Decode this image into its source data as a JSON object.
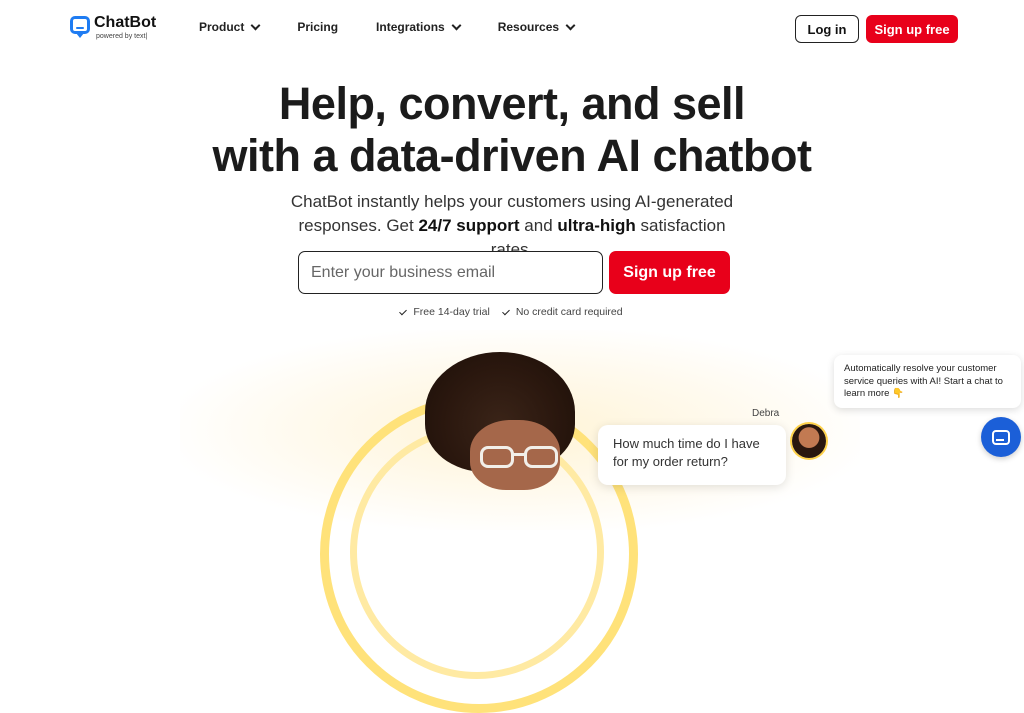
{
  "nav": {
    "logo_name": "ChatBot",
    "logo_sub": "powered by text|",
    "items": [
      {
        "label": "Product",
        "has_dropdown": true
      },
      {
        "label": "Pricing",
        "has_dropdown": false
      },
      {
        "label": "Integrations",
        "has_dropdown": true
      },
      {
        "label": "Resources",
        "has_dropdown": true
      }
    ],
    "login_label": "Log in",
    "signup_label": "Sign up free"
  },
  "hero": {
    "headline_line1": "Help, convert, and sell",
    "headline_line2": "with a data-driven AI chatbot",
    "sub_part1": "ChatBot instantly helps your customers using AI-generated responses. Get ",
    "sub_bold1": "24/7 support",
    "sub_part2": " and ",
    "sub_bold2": "ultra-high",
    "sub_part3": " satisfaction rates.",
    "email_placeholder": "Enter your business email",
    "email_value": "",
    "cta_label": "Sign up free",
    "perks": [
      "Free 14-day trial",
      "No credit card required"
    ]
  },
  "illustration": {
    "chat_name": "Debra",
    "chat_message": "How much time do I have for my order return?"
  },
  "widget": {
    "promo_text": "Automatically resolve your customer service queries with AI! Start a chat to learn more 👇",
    "launcher_icon": "chat-icon"
  },
  "colors": {
    "brand_red": "#e8001a",
    "brand_blue": "#1f7cf2",
    "launcher_blue": "#1b5fd8",
    "accent_yellow": "#ffe27a"
  }
}
